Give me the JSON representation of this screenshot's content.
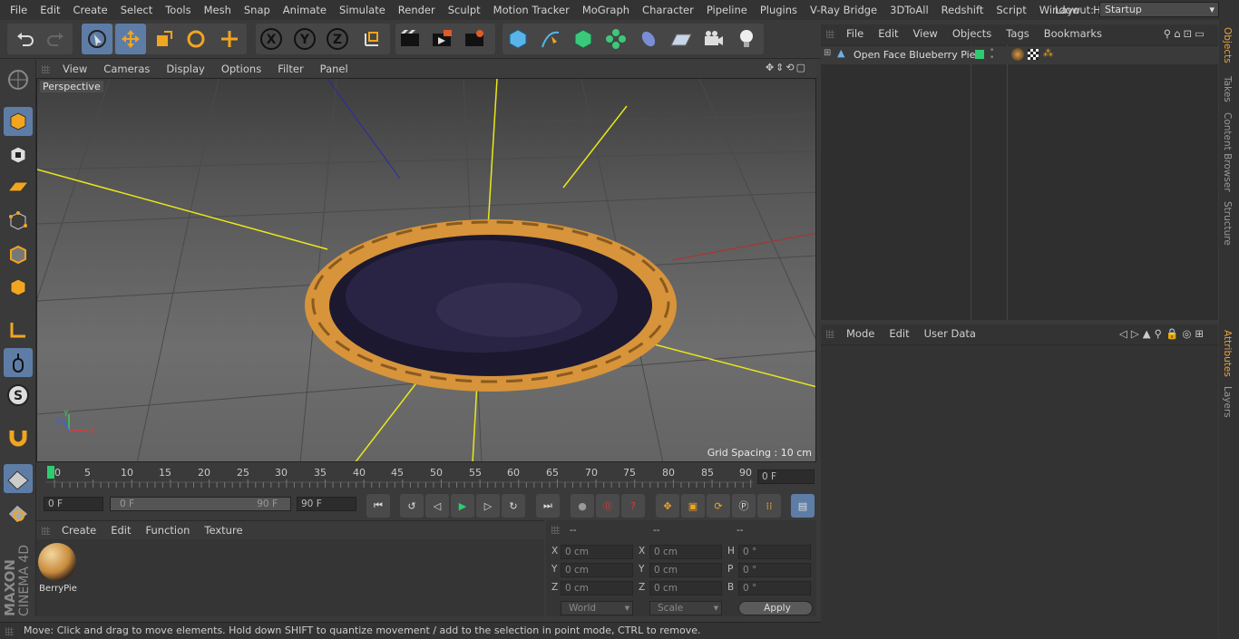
{
  "menu": [
    "File",
    "Edit",
    "Create",
    "Select",
    "Tools",
    "Mesh",
    "Snap",
    "Animate",
    "Simulate",
    "Render",
    "Sculpt",
    "Motion Tracker",
    "MoGraph",
    "Character",
    "Pipeline",
    "Plugins",
    "V-Ray Bridge",
    "3DToAll",
    "Redshift",
    "Script",
    "Window",
    "Help"
  ],
  "layout": {
    "label": "Layout:",
    "value": "Startup"
  },
  "viewport": {
    "menu": [
      "View",
      "Cameras",
      "Display",
      "Options",
      "Filter",
      "Panel"
    ],
    "camera": "Perspective",
    "grid_spacing": "Grid Spacing : 10 cm"
  },
  "timeline": {
    "ticks": [
      "0",
      "5",
      "10",
      "15",
      "20",
      "25",
      "30",
      "35",
      "40",
      "45",
      "50",
      "55",
      "60",
      "65",
      "70",
      "75",
      "80",
      "85",
      "90"
    ],
    "current_frame": "0 F"
  },
  "transport": {
    "start": "0 F",
    "range_start": "0 F",
    "range_end": "90 F",
    "end": "90 F"
  },
  "materials": {
    "menu": [
      "Create",
      "Edit",
      "Function",
      "Texture"
    ],
    "items": [
      {
        "name": "BerryPie"
      }
    ]
  },
  "coords": {
    "headers": [
      "--",
      "--",
      "--"
    ],
    "rows": [
      [
        "X",
        "0 cm",
        "X",
        "0 cm",
        "H",
        "0 °"
      ],
      [
        "Y",
        "0 cm",
        "Y",
        "0 cm",
        "P",
        "0 °"
      ],
      [
        "Z",
        "0 cm",
        "Z",
        "0 cm",
        "B",
        "0 °"
      ]
    ],
    "mode1": "World",
    "mode2": "Scale",
    "apply": "Apply"
  },
  "objects": {
    "menu": [
      "File",
      "Edit",
      "View",
      "Objects",
      "Tags",
      "Bookmarks"
    ],
    "items": [
      {
        "name": "Open Face Blueberry Pie"
      }
    ]
  },
  "attributes": {
    "menu": [
      "Mode",
      "Edit",
      "User Data"
    ]
  },
  "sidetabs": {
    "top": [
      "Objects",
      "Takes",
      "Content Browser",
      "Structure"
    ],
    "bottom": [
      "Attributes",
      "Layers"
    ]
  },
  "status": "Move: Click and drag to move elements. Hold down SHIFT to quantize movement / add to the selection in point mode, CTRL to remove.",
  "brand": {
    "line1": "MAXON",
    "line2": "CINEMA 4D"
  },
  "colors": {
    "accent": "#5e7da6",
    "tab_active": "#e8a33b",
    "play_green": "#2ecc71",
    "record_red": "#d93a3a"
  }
}
